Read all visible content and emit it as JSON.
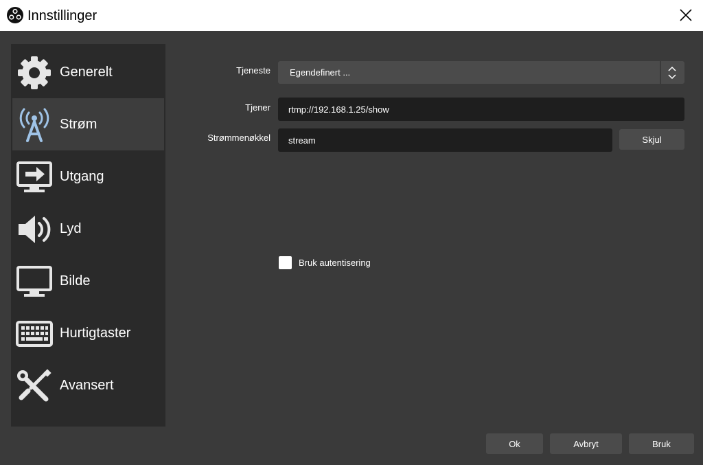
{
  "window": {
    "title": "Innstillinger",
    "app_icon": "obs-logo-icon",
    "close_icon": "close-icon"
  },
  "sidebar": {
    "items": [
      {
        "label": "Generelt",
        "icon": "gear-icon",
        "selected": false
      },
      {
        "label": "Strøm",
        "icon": "broadcast-tower-icon",
        "selected": true
      },
      {
        "label": "Utgang",
        "icon": "monitor-output-icon",
        "selected": false
      },
      {
        "label": "Lyd",
        "icon": "speaker-icon",
        "selected": false
      },
      {
        "label": "Bilde",
        "icon": "monitor-icon",
        "selected": false
      },
      {
        "label": "Hurtigtaster",
        "icon": "keyboard-icon",
        "selected": false
      },
      {
        "label": "Avansert",
        "icon": "wrench-screwdriver-icon",
        "selected": false
      }
    ]
  },
  "stream": {
    "service_label": "Tjeneste",
    "service_value": "Egendefinert ...",
    "server_label": "Tjener",
    "server_value": "rtmp://192.168.1.25/show",
    "key_label": "Strømmenøkkel",
    "key_value": "stream",
    "hide_button": "Skjul",
    "auth_label": "Bruk autentisering",
    "auth_checked": false
  },
  "footer": {
    "ok": "Ok",
    "cancel": "Avbryt",
    "apply": "Bruk"
  },
  "colors": {
    "background": "#3a3a3a",
    "sidebar": "#2a2a2a",
    "selected_item": "#3d3d3d",
    "input": "#1e1e1e",
    "button": "#4b4b4b",
    "accent_icon": "#9fc3e7"
  }
}
